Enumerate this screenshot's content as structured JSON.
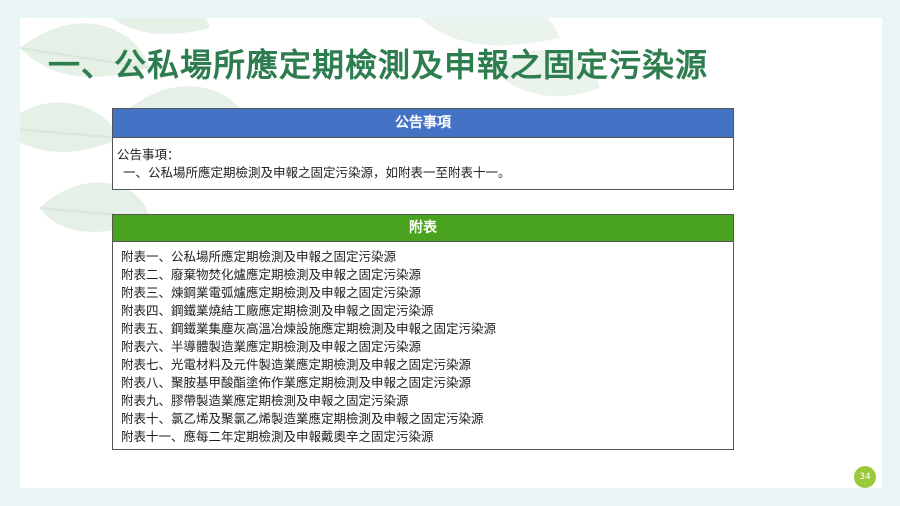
{
  "title": "一、公私場所應定期檢測及申報之固定污染源",
  "announcement": {
    "header": "公告事項",
    "label": "公告事項：",
    "text": "一、公私場所應定期檢測及申報之固定污染源，如附表一至附表十一。"
  },
  "appendix": {
    "header": "附表",
    "items": [
      "附表一、公私場所應定期檢測及申報之固定污染源",
      "附表二、廢棄物焚化爐應定期檢測及申報之固定污染源",
      "附表三、煉鋼業電弧爐應定期檢測及申報之固定污染源",
      "附表四、鋼鐵業燒結工廠應定期檢測及申報之固定污染源",
      "附表五、鋼鐵業集塵灰高溫冶煉設施應定期檢測及申報之固定污染源",
      "附表六、半導體製造業應定期檢測及申報之固定污染源",
      "附表七、光電材料及元件製造業應定期檢測及申報之固定污染源",
      "附表八、聚胺基甲酸酯塗佈作業應定期檢測及申報之固定污染源",
      "附表九、膠帶製造業應定期檢測及申報之固定污染源",
      "附表十、氯乙烯及聚氯乙烯製造業應定期檢測及申報之固定污染源",
      "附表十一、應每二年定期檢測及申報戴奧辛之固定污染源"
    ]
  },
  "page_number": "34",
  "colors": {
    "title": "#2e7d4f",
    "header_blue": "#4472c4",
    "header_green": "#4aa31e",
    "page_badge": "#9bc93a"
  }
}
